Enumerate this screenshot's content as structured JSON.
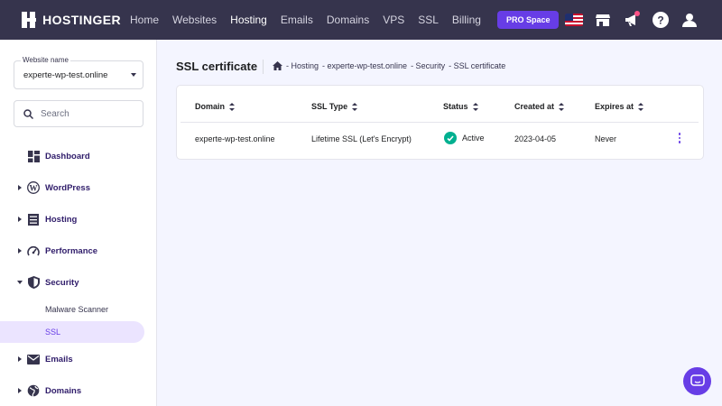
{
  "brand": {
    "name": "HOSTINGER"
  },
  "topnav": {
    "items": [
      {
        "label": "Home",
        "active": false
      },
      {
        "label": "Websites",
        "active": false
      },
      {
        "label": "Hosting",
        "active": true
      },
      {
        "label": "Emails",
        "active": false
      },
      {
        "label": "Domains",
        "active": false
      },
      {
        "label": "VPS",
        "active": false
      },
      {
        "label": "SSL",
        "active": false
      },
      {
        "label": "Billing",
        "active": false
      }
    ],
    "pro_button": "PRO Space",
    "icons": [
      "us-flag-icon",
      "store-icon",
      "megaphone-icon",
      "help-icon",
      "account-icon"
    ]
  },
  "sidebar": {
    "website_select": {
      "label": "Website name",
      "value": "experte-wp-test.online"
    },
    "search": {
      "placeholder": "Search"
    },
    "items": [
      {
        "label": "Dashboard",
        "icon": "dashboard-icon",
        "expandable": false
      },
      {
        "label": "WordPress",
        "icon": "wordpress-icon",
        "expandable": true
      },
      {
        "label": "Hosting",
        "icon": "server-icon",
        "expandable": true
      },
      {
        "label": "Performance",
        "icon": "speedometer-icon",
        "expandable": true
      },
      {
        "label": "Security",
        "icon": "shield-icon",
        "expandable": true,
        "expanded": true
      },
      {
        "label": "Emails",
        "icon": "mail-icon",
        "expandable": true
      },
      {
        "label": "Domains",
        "icon": "globe-icon",
        "expandable": true
      }
    ],
    "security_sub": [
      {
        "label": "Malware Scanner",
        "active": false
      },
      {
        "label": "SSL",
        "active": true
      }
    ]
  },
  "main": {
    "title": "SSL certificate",
    "breadcrumb": [
      "- Hosting",
      "- experte-wp-test.online",
      "- Security",
      "- SSL certificate"
    ],
    "table": {
      "columns": [
        "Domain",
        "SSL Type",
        "Status",
        "Created at",
        "Expires at"
      ],
      "rows": [
        {
          "domain": "experte-wp-test.online",
          "ssl_type": "Lifetime SSL (Let's Encrypt)",
          "status": "Active",
          "created_at": "2023-04-05",
          "expires_at": "Never"
        }
      ]
    }
  },
  "colors": {
    "topbar": "#36344d",
    "accent": "#673de6",
    "active_status": "#00b090",
    "background": "#f4f5ff"
  }
}
